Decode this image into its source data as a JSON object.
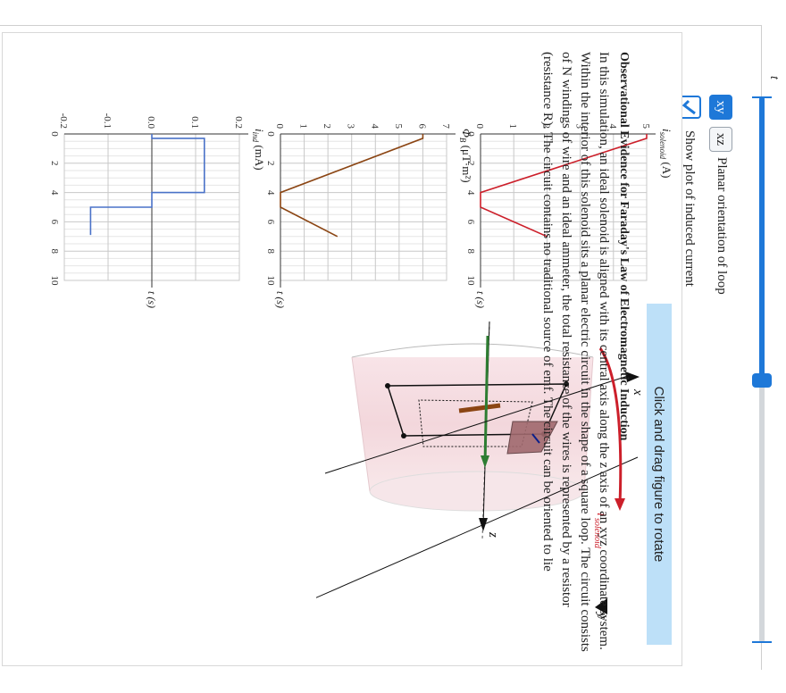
{
  "controls": {
    "slider_label": "t",
    "slider_value_fraction": 0.52,
    "buttons": [
      {
        "name": "play-icon",
        "glyph": "▶"
      },
      {
        "name": "pause-icon",
        "glyph": "❚❚"
      },
      {
        "name": "reset-icon",
        "glyph": "↻"
      }
    ],
    "orientation_options": [
      "xy",
      "xz"
    ],
    "orientation_selected": "xy",
    "orientation_label": "Planar orientation of loop",
    "show_plot_label": "Show plot of induced current",
    "show_plot_checked": true
  },
  "chart_data": [
    {
      "type": "line",
      "title": "",
      "ylabel": "i_solenoid (A)",
      "ylabel_main": "i",
      "ylabel_sub": "solenoid",
      "ylabel_unit": "(A)",
      "xlabel": "t (s)",
      "xlim": [
        0,
        10
      ],
      "ylim": [
        0,
        5
      ],
      "xticks": [
        "0",
        "2",
        "4",
        "6",
        "8",
        "10"
      ],
      "yticks": [
        "0",
        "1",
        "2",
        "3",
        "4",
        "5"
      ],
      "color": "#cc1f2a",
      "series": [
        {
          "x": [
            0,
            0.3,
            4,
            5,
            7
          ],
          "y": [
            5,
            5,
            0,
            0,
            2
          ]
        }
      ]
    },
    {
      "type": "line",
      "title": "",
      "ylabel": "Φ_B (μT·m²)",
      "ylabel_main": "Φ",
      "ylabel_sub": "B",
      "ylabel_unit": "(μT·m²)",
      "xlabel": "t (s)",
      "xlim": [
        0,
        10
      ],
      "ylim": [
        0,
        7
      ],
      "xticks": [
        "0",
        "2",
        "4",
        "6",
        "8",
        "10"
      ],
      "yticks": [
        "0",
        "1",
        "2",
        "3",
        "4",
        "5",
        "6",
        "7"
      ],
      "color": "#8b4513",
      "series": [
        {
          "x": [
            0,
            0.3,
            4,
            5,
            7
          ],
          "y": [
            6,
            6,
            0,
            0,
            2.4
          ]
        }
      ]
    },
    {
      "type": "line",
      "title": "",
      "ylabel": "i_ind (mA)",
      "ylabel_main": "i",
      "ylabel_sub": "ind",
      "ylabel_unit": "(mA)",
      "xlabel": "t (s)",
      "xlim": [
        0,
        10
      ],
      "ylim": [
        -0.2,
        0.2
      ],
      "xticks": [
        "0",
        "2",
        "4",
        "6",
        "8",
        "10"
      ],
      "yticks": [
        "-0.2",
        "-0.1",
        "0.0",
        "0.1",
        "0.2"
      ],
      "color": "#4a72c8",
      "series": [
        {
          "x": [
            0,
            0.3,
            0.3,
            4,
            4,
            5,
            5,
            6.9
          ],
          "y": [
            0,
            0,
            0.12,
            0.12,
            0,
            0,
            -0.14,
            -0.14
          ]
        }
      ]
    }
  ],
  "diagram": {
    "hint": "Click and drag figure to rotate",
    "axis_labels": {
      "z": "z",
      "x": "x",
      "y": "y"
    },
    "current_label_main": "i",
    "current_label_sub": "solenoid"
  },
  "description": {
    "heading": "Observational Evidence for Faraday's Law of Electromagnetic Induction",
    "paragraph": "In this simulation, an ideal solenoid is aligned with its central axis along the z axis of an xyz coordinate system. Within the interior of this solenoid sits a planar electric circuit in the shape of a square loop. The circuit consists of N windings of wire and an ideal ammeter, the total resistance of the wires is represented by a resistor (resistance R). The circuit contains no traditional source of emf. The circuit can be oriented to lie"
  },
  "colors": {
    "accent": "#1e78d8",
    "solenoid": "#cc1f2a",
    "flux": "#8b4513",
    "induced": "#4a72c8",
    "hint_bg": "#bde0f8"
  }
}
